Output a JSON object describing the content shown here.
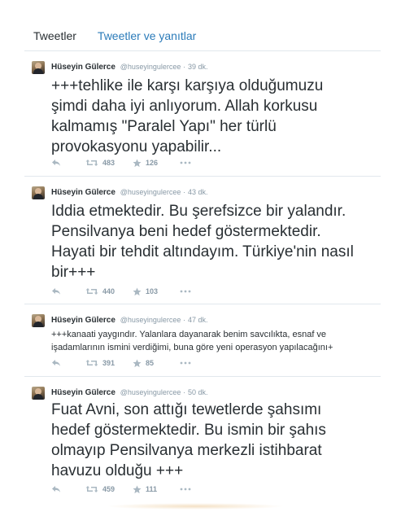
{
  "tabs": [
    {
      "label": "Tweetler",
      "active": true
    },
    {
      "label": "Tweetler ve yanıtlar",
      "active": false
    }
  ],
  "tweets": [
    {
      "name": "Hüseyin Gülerce",
      "handle": "@huseyingulercee",
      "time": "39 dk.",
      "lines": [
        "+++tehlike ile karşı karşıya olduğumuzu",
        "şimdi daha iyi anlıyorum. Allah korkusu",
        "kalmamış \"Paralel Yapı\" her türlü",
        "provokasyonu yapabilir..."
      ],
      "retweets": "483",
      "favorites": "126"
    },
    {
      "name": "Hüseyin Gülerce",
      "handle": "@huseyingulercee",
      "time": "43 dk.",
      "lines": [
        "Iddia etmektedir. Bu şerefsizce bir yalandır.",
        "Pensilvanya beni hedef göstermektedir.",
        "Hayati bir tehdit altındayım. Türkiye'nin nasıl",
        "bir+++"
      ],
      "retweets": "440",
      "favorites": "103"
    },
    {
      "name": "Hüseyin Gülerce",
      "handle": "@huseyingulercee",
      "time": "47 dk.",
      "lines": [
        "+++kanaati yaygındır. Yalanlara dayanarak benim savcılıkta, esnaf ve",
        "işadamlarının ismini verdiğimi, buna göre yeni operasyon yapılacağını+"
      ],
      "retweets": "391",
      "favorites": "85"
    },
    {
      "name": "Hüseyin Gülerce",
      "handle": "@huseyingulercee",
      "time": "50 dk.",
      "lines": [
        "Fuat Avni, son attığı tewetlerde şahsımı",
        "hedef göstermektedir. Bu ismin bir şahıs",
        "olmayıp Pensilvanya merkezli istihbarat",
        "havuzu olduğu +++"
      ],
      "retweets": "459",
      "favorites": "111"
    }
  ],
  "icons": {
    "reply": "reply-icon",
    "retweet": "retweet-icon",
    "favorite": "star-icon",
    "more": "more-icon"
  },
  "colors": {
    "link": "#2b7bb9",
    "text": "#292f33",
    "muted": "#8899a6",
    "icon": "#aab8c2",
    "divider": "#e1e8ed"
  }
}
